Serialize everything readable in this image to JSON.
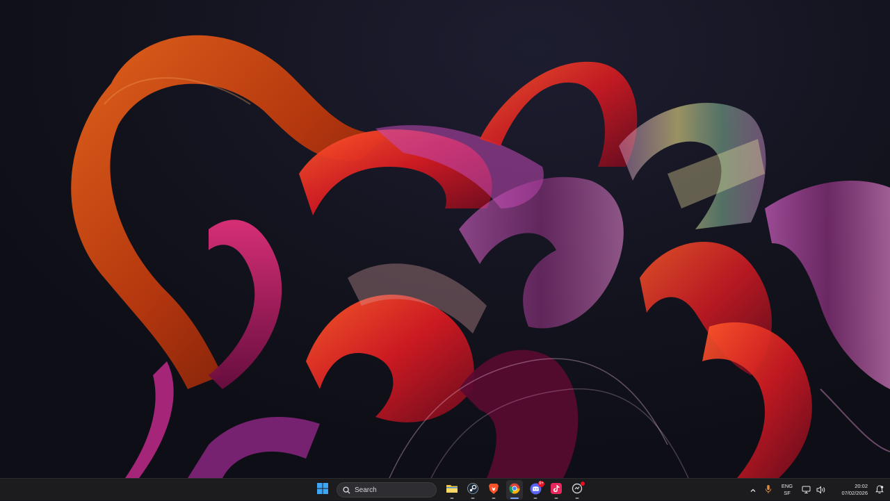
{
  "taskbar": {
    "search_label": "Search",
    "apps": [
      {
        "name": "File Explorer",
        "icon": "folder-icon",
        "running": true,
        "active": false
      },
      {
        "name": "Steam",
        "icon": "steam-icon",
        "running": true,
        "active": false
      },
      {
        "name": "Brave",
        "icon": "brave-icon",
        "running": true,
        "active": false
      },
      {
        "name": "Google Chrome",
        "icon": "chrome-icon",
        "running": true,
        "active": true
      },
      {
        "name": "Discord",
        "icon": "discord-icon",
        "running": true,
        "active": false,
        "badge": "9+"
      },
      {
        "name": "TikTok",
        "icon": "tiktok-icon",
        "running": true,
        "active": false
      },
      {
        "name": "App",
        "icon": "app-icon",
        "running": true,
        "active": false,
        "badge": ""
      }
    ]
  },
  "tray": {
    "language_line1": "ENG",
    "language_line2": "SF",
    "time": "20:02",
    "date": "07/02/2026"
  },
  "colors": {
    "taskbar_bg": "#1c1c1e",
    "accent": "#7aa6ff",
    "badge": "#e81123"
  }
}
